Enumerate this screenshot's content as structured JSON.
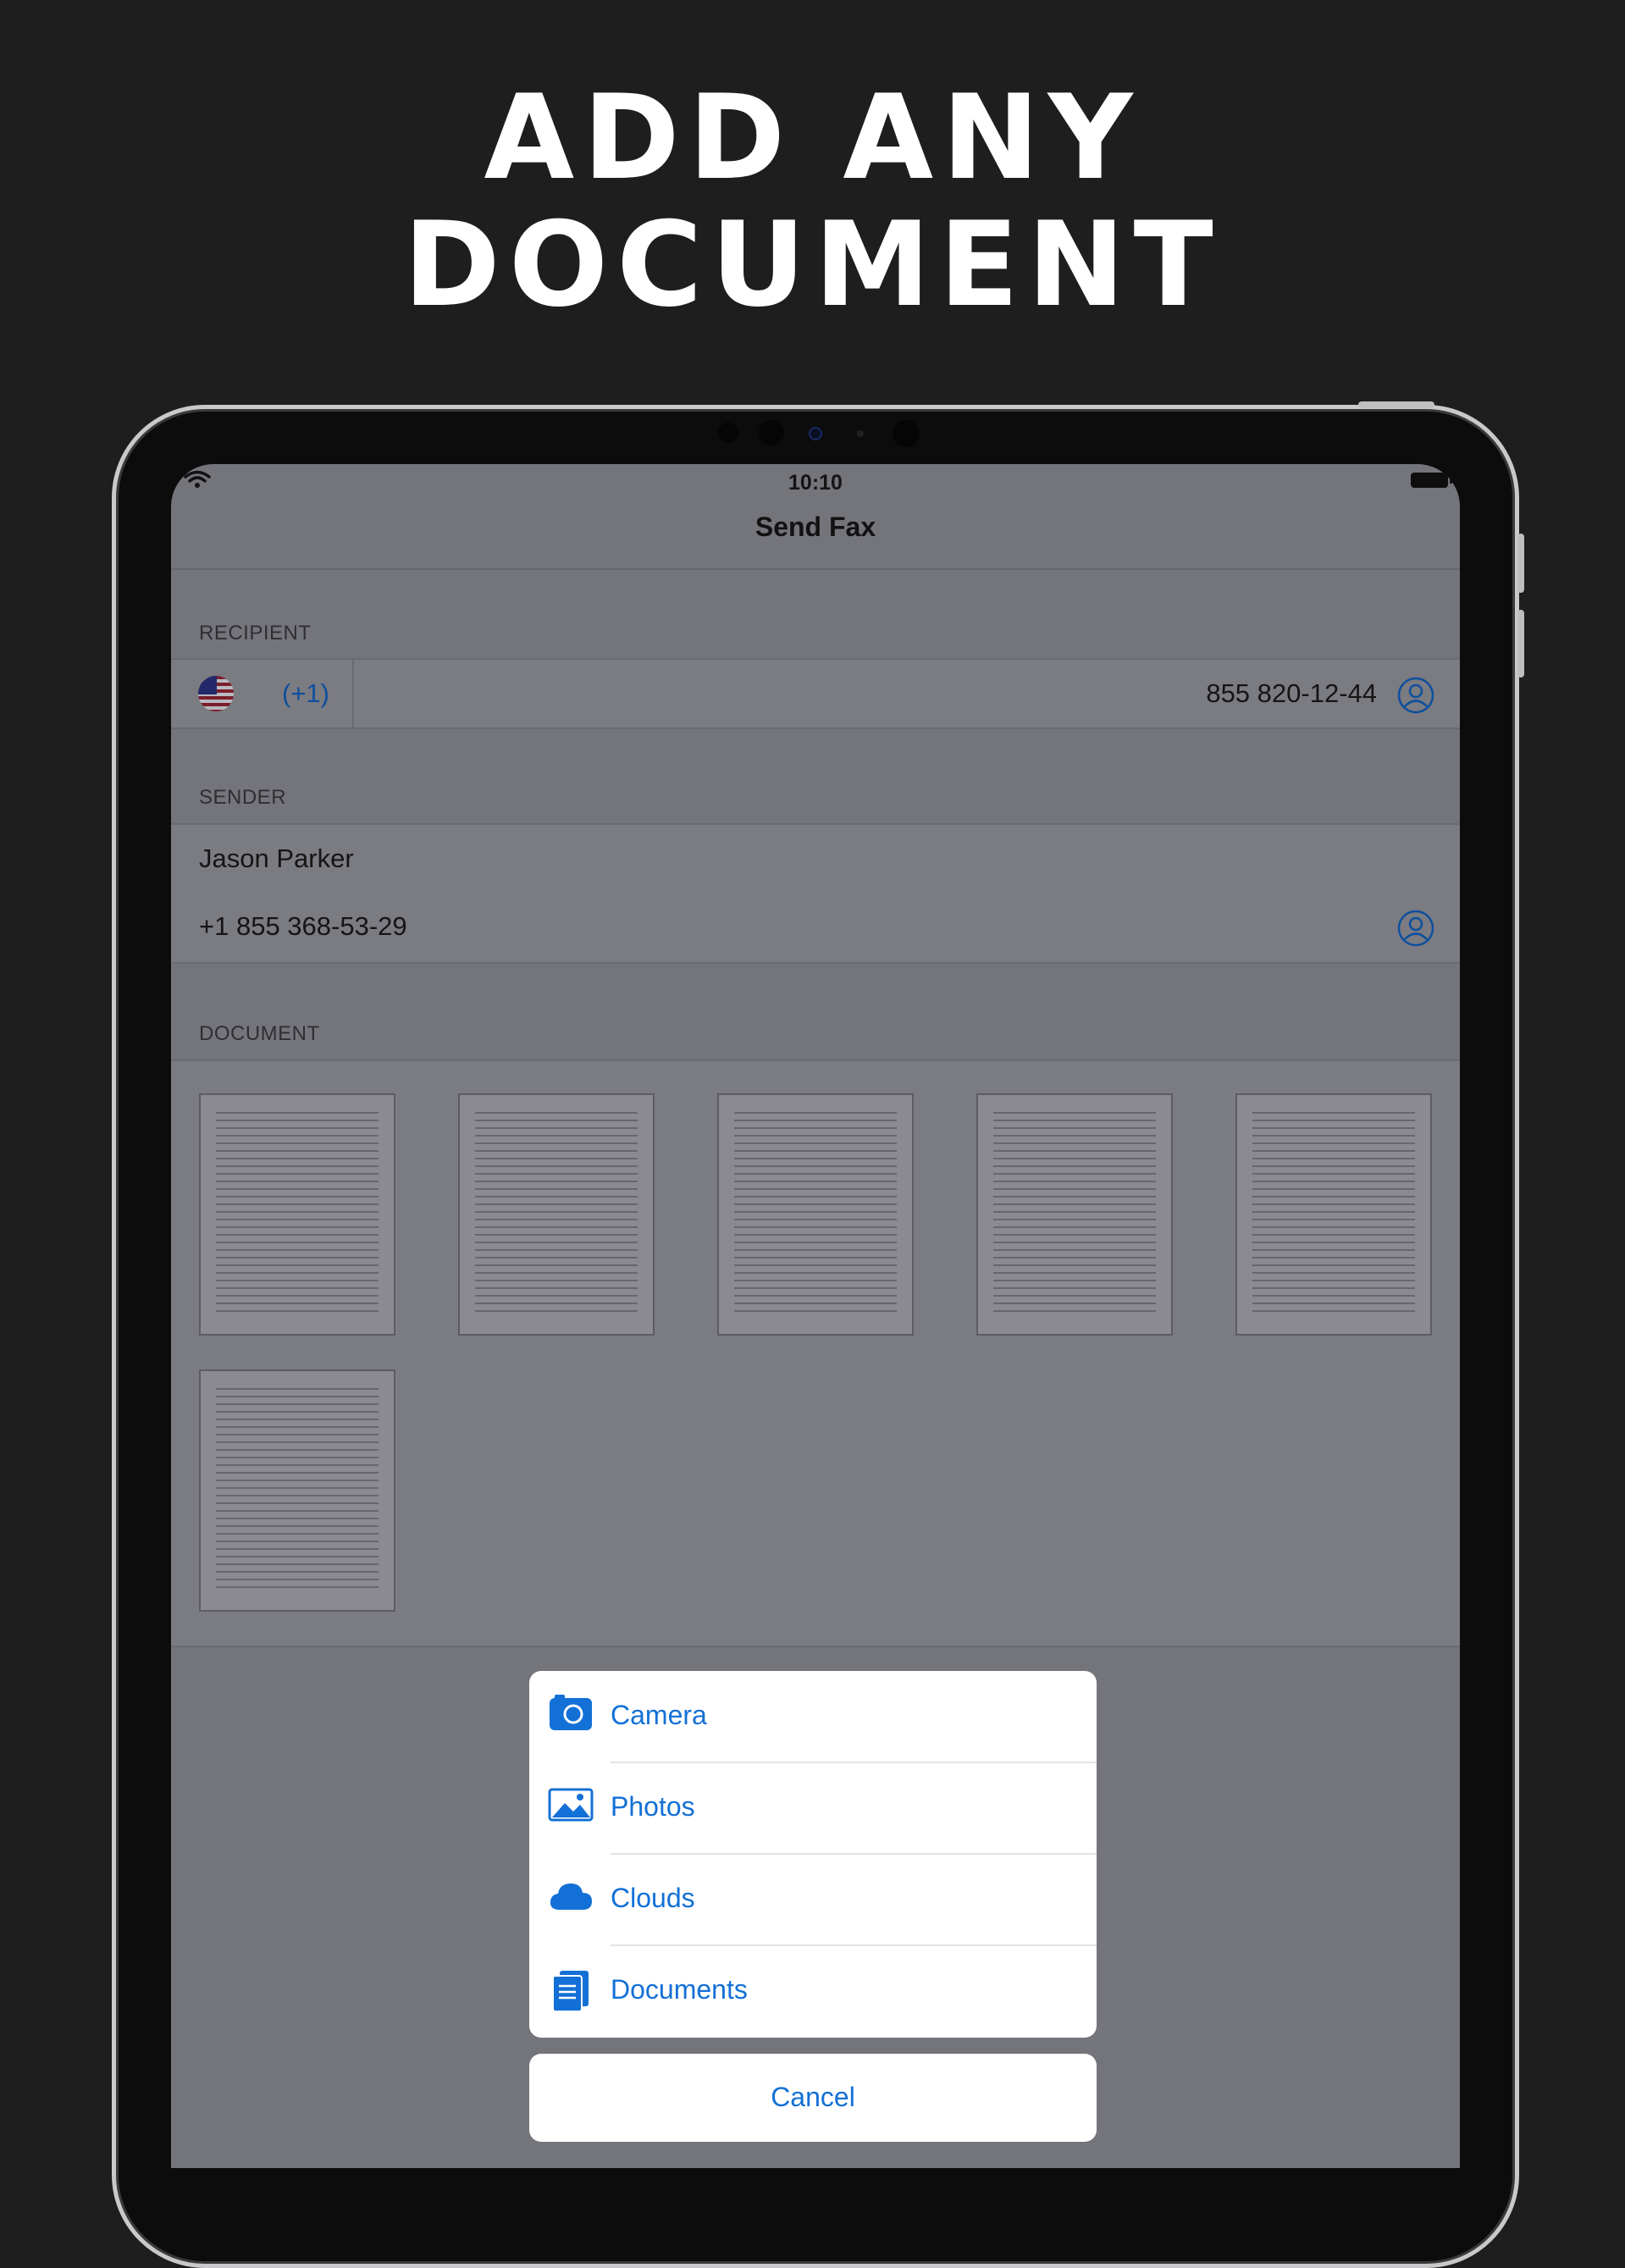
{
  "headline": {
    "line1": "ADD ANY",
    "line2": "DOCUMENT"
  },
  "status_bar": {
    "time": "10:10"
  },
  "nav": {
    "title": "Send Fax"
  },
  "recipient": {
    "section_label": "RECIPIENT",
    "dial_code": "(+1)",
    "phone": "855 820-12-44"
  },
  "sender": {
    "section_label": "SENDER",
    "name": "Jason Parker",
    "phone": "+1 855 368-53-29"
  },
  "document": {
    "section_label": "DOCUMENT",
    "thumbnail_count": 6
  },
  "action_sheet": {
    "items": [
      {
        "label": "Camera",
        "icon": "camera-icon"
      },
      {
        "label": "Photos",
        "icon": "photos-icon"
      },
      {
        "label": "Clouds",
        "icon": "cloud-icon"
      },
      {
        "label": "Documents",
        "icon": "documents-icon"
      }
    ],
    "cancel_label": "Cancel"
  },
  "colors": {
    "accent": "#1370d6",
    "background": "#1e1e1f",
    "dimmed_screen": "#74747b"
  }
}
